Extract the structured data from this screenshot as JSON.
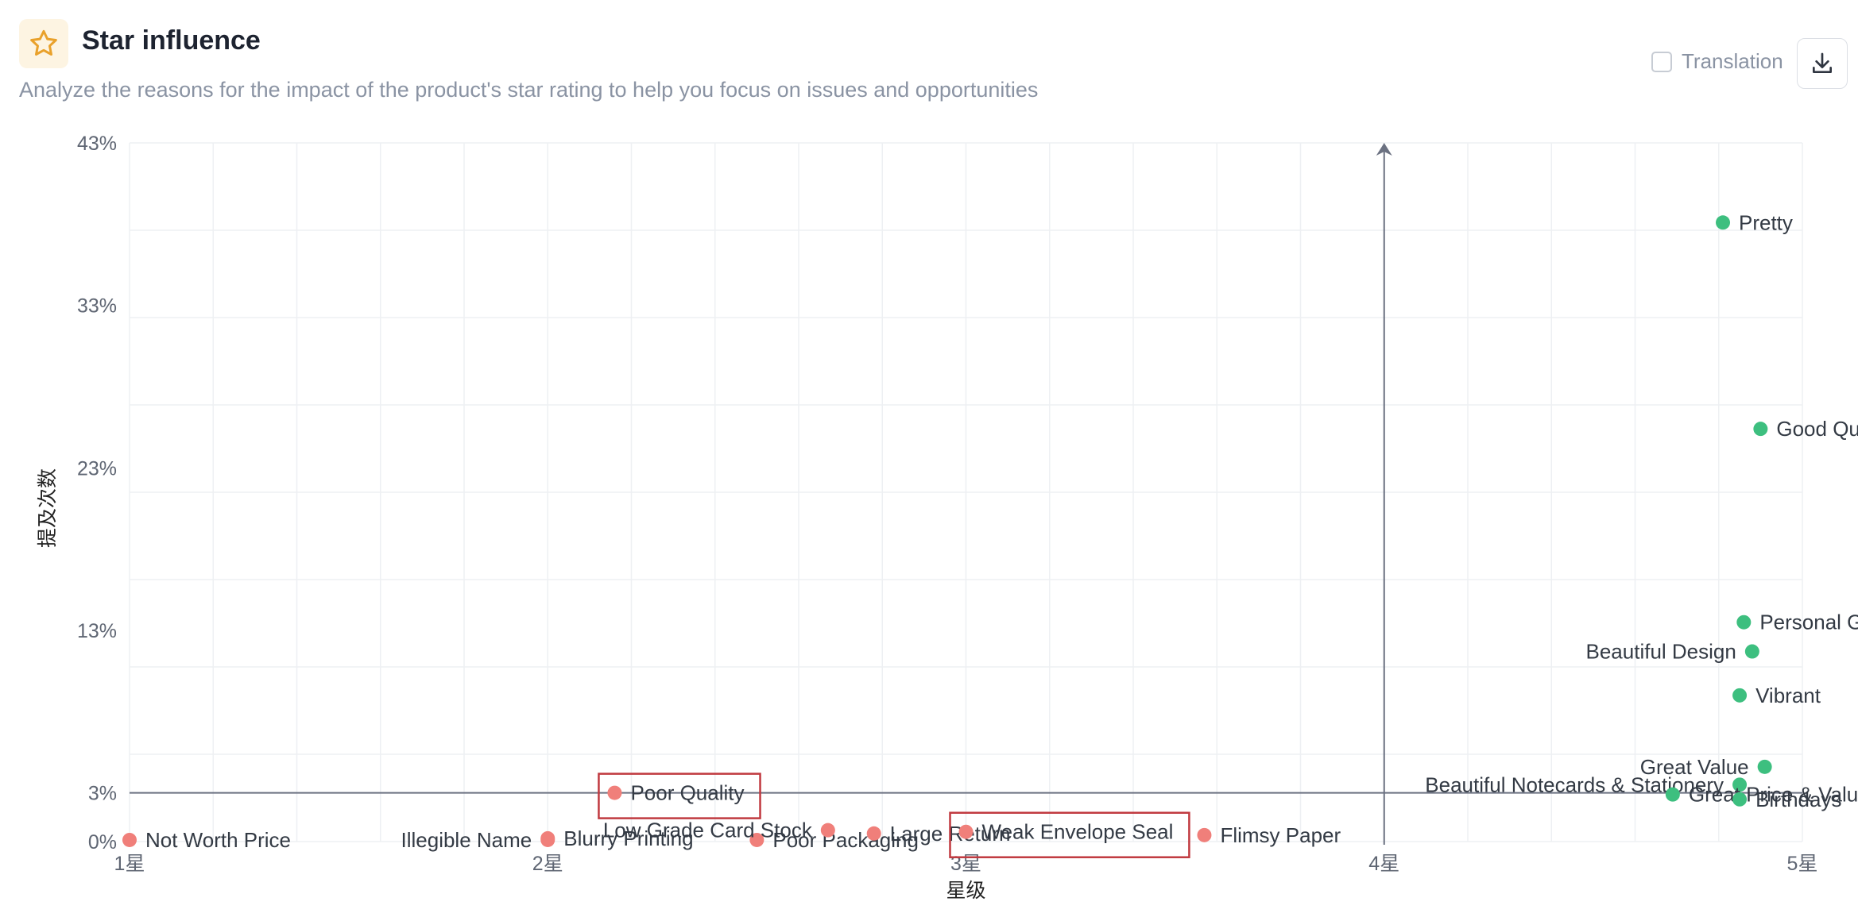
{
  "header": {
    "title": "Star influence",
    "subtitle": "Analyze the reasons for the impact of the product's star rating to help you focus on issues and opportunities",
    "icon": "star-icon",
    "translation_label": "Translation",
    "translation_checked": false,
    "download_icon": "download-icon"
  },
  "colors": {
    "positive": "#3dbf7f",
    "negative": "#f07f7a",
    "highlight_box": "#c0393f",
    "axis_arrow": "#6b7181",
    "grid": "#eef0f3"
  },
  "chart_data": {
    "type": "scatter",
    "title": "",
    "xlabel": "星级",
    "ylabel": "提及次数",
    "xlim": [
      1,
      5
    ],
    "ylim": [
      0,
      43
    ],
    "x_ticks": [
      {
        "value": 1,
        "label": "1星"
      },
      {
        "value": 2,
        "label": "2星"
      },
      {
        "value": 3,
        "label": "3星"
      },
      {
        "value": 4,
        "label": "4星"
      },
      {
        "value": 5,
        "label": "5星"
      }
    ],
    "y_ticks": [
      {
        "value": 0,
        "label": "0%"
      },
      {
        "value": 3,
        "label": "3%"
      },
      {
        "value": 13,
        "label": "13%"
      },
      {
        "value": 23,
        "label": "23%"
      },
      {
        "value": 33,
        "label": "33%"
      },
      {
        "value": 43,
        "label": "43%"
      }
    ],
    "grid": true,
    "reference_lines": {
      "x": 4,
      "y": 3
    },
    "points": [
      {
        "label": "Not Worth Price",
        "x": 1.0,
        "y": 0.1,
        "sentiment": "negative",
        "label_side": "right"
      },
      {
        "label": "Illegible Name",
        "x": 2.0,
        "y": 0.1,
        "sentiment": "negative",
        "label_side": "left"
      },
      {
        "label": "Blurry Printing",
        "x": 2.0,
        "y": 0.2,
        "sentiment": "negative",
        "label_side": "right"
      },
      {
        "label": "Poor Quality",
        "x": 2.16,
        "y": 3.0,
        "sentiment": "negative",
        "label_side": "right",
        "highlighted": true
      },
      {
        "label": "Poor Packaging",
        "x": 2.5,
        "y": 0.1,
        "sentiment": "negative",
        "label_side": "right"
      },
      {
        "label": "Low Grade Card Stock",
        "x": 2.67,
        "y": 0.7,
        "sentiment": "negative",
        "label_side": "left"
      },
      {
        "label": "Large Return",
        "x": 2.78,
        "y": 0.5,
        "sentiment": "negative",
        "label_side": "right"
      },
      {
        "label": "Weak Envelope Seal",
        "x": 3.0,
        "y": 0.6,
        "sentiment": "negative",
        "label_side": "right",
        "highlighted": true
      },
      {
        "label": "Flimsy Paper",
        "x": 3.57,
        "y": 0.4,
        "sentiment": "negative",
        "label_side": "right"
      },
      {
        "label": "Pretty",
        "x": 4.81,
        "y": 38.1,
        "sentiment": "positive",
        "label_side": "right"
      },
      {
        "label": "Good Quality",
        "x": 4.9,
        "y": 25.4,
        "sentiment": "positive",
        "label_side": "right"
      },
      {
        "label": "Personal Greeting",
        "x": 4.86,
        "y": 13.5,
        "sentiment": "positive",
        "label_side": "right"
      },
      {
        "label": "Beautiful Design",
        "x": 4.88,
        "y": 11.7,
        "sentiment": "positive",
        "label_side": "left"
      },
      {
        "label": "Vibrant",
        "x": 4.85,
        "y": 9.0,
        "sentiment": "positive",
        "label_side": "right"
      },
      {
        "label": "Great Value",
        "x": 4.91,
        "y": 4.6,
        "sentiment": "positive",
        "label_side": "left"
      },
      {
        "label": "Beautiful Notecards & Stationery",
        "x": 4.85,
        "y": 3.5,
        "sentiment": "positive",
        "label_side": "left"
      },
      {
        "label": "Great Price & Value",
        "x": 4.69,
        "y": 2.9,
        "sentiment": "positive",
        "label_side": "right"
      },
      {
        "label": "Birthdays",
        "x": 4.85,
        "y": 2.6,
        "sentiment": "positive",
        "label_side": "right"
      }
    ]
  }
}
